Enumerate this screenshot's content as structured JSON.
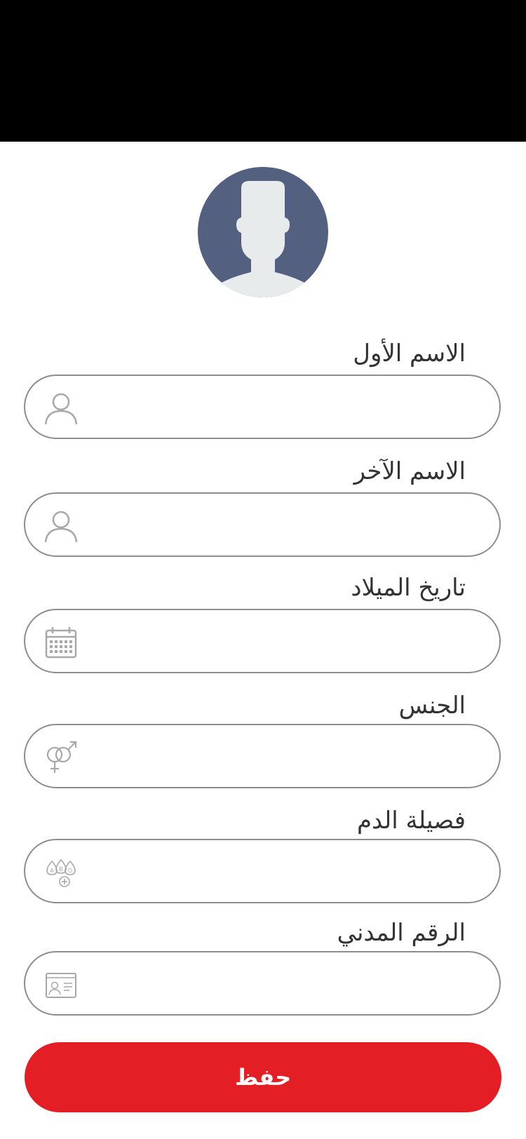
{
  "form": {
    "fields": [
      {
        "label": "الاسم الأول",
        "value": "",
        "icon": "user-icon"
      },
      {
        "label": "الاسم الآخر",
        "value": "",
        "icon": "user-icon"
      },
      {
        "label": "تاريخ الميلاد",
        "value": "",
        "icon": "calendar-icon"
      },
      {
        "label": "الجنس",
        "value": "",
        "icon": "gender-icon"
      },
      {
        "label": "فصيلة الدم",
        "value": "",
        "icon": "blood-type-icon"
      },
      {
        "label": "الرقم المدني",
        "value": "",
        "icon": "id-card-icon"
      }
    ],
    "save_label": "حفظ"
  },
  "colors": {
    "status_bar": "#000000",
    "avatar_bg": "#54607f",
    "primary_button": "#e31e25",
    "field_border": "#8d8d8d",
    "icon_gray": "#a8a8a8"
  }
}
